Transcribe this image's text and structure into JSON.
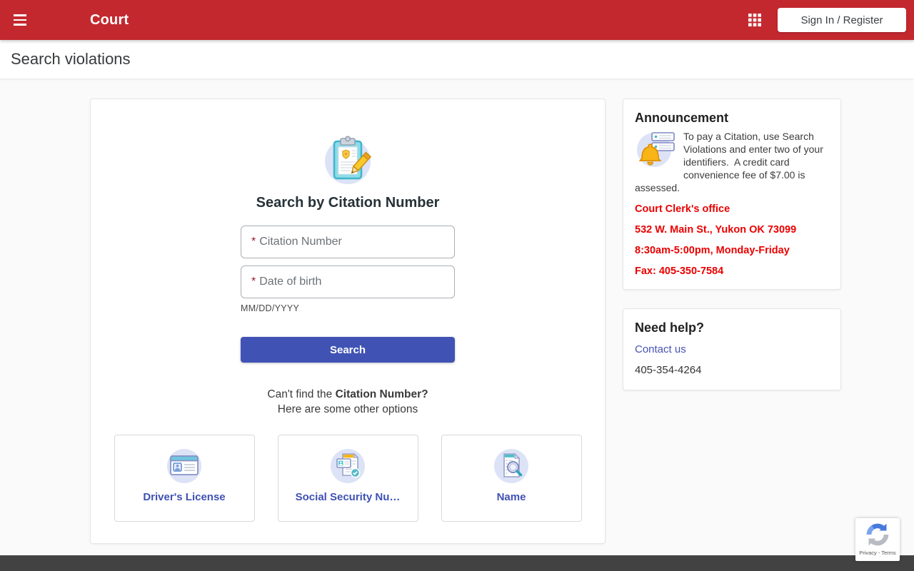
{
  "header": {
    "title": "Court",
    "sign_in_label": "Sign In / Register"
  },
  "page": {
    "title": "Search violations"
  },
  "search_card": {
    "heading": "Search by Citation Number",
    "citation_field": {
      "required_marker": "*",
      "placeholder": "Citation Number"
    },
    "dob_field": {
      "required_marker": "*",
      "placeholder": "Date of birth",
      "hint": "MM/DD/YYYY"
    },
    "search_button": "Search",
    "alt_prompt": {
      "prefix": "Can't find the ",
      "bold": "Citation Number?",
      "line2": "Here are some other options"
    },
    "options": [
      {
        "label": "Driver's License"
      },
      {
        "label": "Social Security Nu…"
      },
      {
        "label": "Name"
      }
    ]
  },
  "announcement": {
    "heading": "Announcement",
    "body": "To pay a Citation, use Search Violations and enter two of your identifiers.  A credit card convenience fee of $7.00 is assessed.",
    "office_lines": [
      "Court Clerk's office",
      "532 W. Main St., Yukon OK 73099",
      "8:30am-5:00pm, Monday-Friday",
      "Fax: 405-350-7584"
    ]
  },
  "need_help": {
    "heading": "Need help?",
    "contact_link": "Contact us",
    "phone": "405-354-4264"
  },
  "recaptcha": {
    "privacy_terms": "Privacy - Terms"
  },
  "colors": {
    "header_red": "#c4282f",
    "accent_indigo": "#4053b5",
    "announcement_red": "#ea0000",
    "footer_gray": "#424242"
  }
}
